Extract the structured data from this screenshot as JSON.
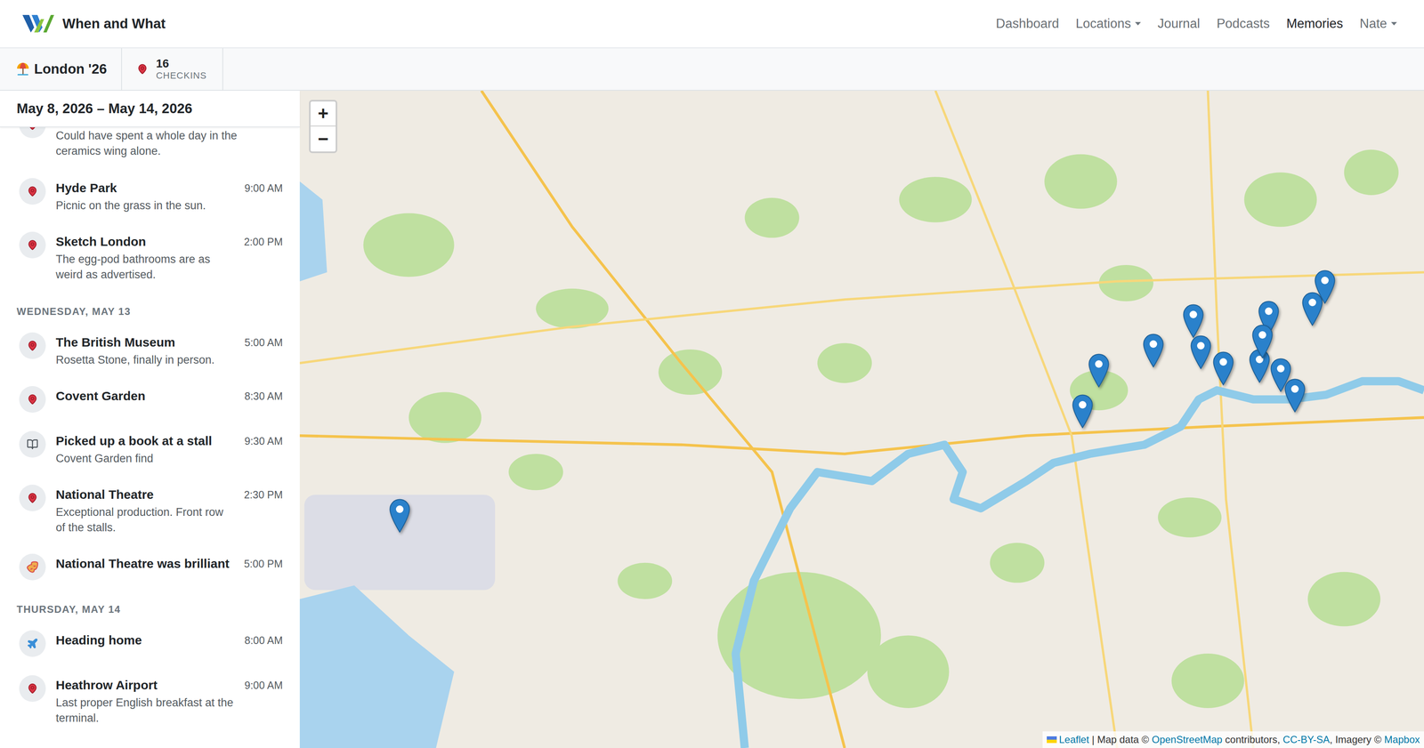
{
  "app": {
    "brand": "When and What"
  },
  "nav": [
    {
      "label": "Dashboard",
      "selected": false,
      "dropdown": false
    },
    {
      "label": "Locations",
      "selected": false,
      "dropdown": true
    },
    {
      "label": "Journal",
      "selected": false,
      "dropdown": false
    },
    {
      "label": "Podcasts",
      "selected": false,
      "dropdown": false
    },
    {
      "label": "Memories",
      "selected": true,
      "dropdown": false
    },
    {
      "label": "Nate",
      "selected": false,
      "dropdown": true
    }
  ],
  "trip": {
    "name": "London '26",
    "checkins_count": "16",
    "checkins_label": "CHECKINS"
  },
  "timeline": {
    "date_range": "May 8, 2026 – May 14, 2026",
    "days": [
      {
        "entries": [
          {
            "kind": "checkin",
            "clipped": true,
            "note": "Could have spent a whole day in the ceramics wing alone."
          },
          {
            "kind": "checkin",
            "clipped": false,
            "title": "Hyde Park",
            "time": "9:00 AM",
            "note": "Picnic on the grass in the sun."
          },
          {
            "kind": "checkin",
            "clipped": false,
            "title": "Sketch London",
            "time": "2:00 PM",
            "note": "The egg-pod bathrooms are as weird as advertised."
          }
        ]
      },
      {
        "label": "WEDNESDAY, MAY 13",
        "entries": [
          {
            "kind": "checkin",
            "clipped": false,
            "title": "The British Museum",
            "time": "5:00 AM",
            "note": "Rosetta Stone, finally in person."
          },
          {
            "kind": "checkin",
            "clipped": false,
            "title": "Covent Garden",
            "time": "8:30 AM"
          },
          {
            "kind": "book",
            "clipped": false,
            "title": "Picked up a book at a stall",
            "time": "9:30 AM",
            "note": "Covent Garden find"
          },
          {
            "kind": "checkin",
            "clipped": false,
            "title": "National Theatre",
            "time": "2:30 PM",
            "note": "Exceptional production. Front row of the stalls."
          },
          {
            "kind": "memory",
            "clipped": false,
            "title": "National Theatre was brilliant",
            "time": "5:00 PM"
          }
        ]
      },
      {
        "label": "THURSDAY, MAY 14",
        "entries": [
          {
            "kind": "flight",
            "clipped": false,
            "title": "Heading home",
            "time": "8:00 AM"
          },
          {
            "kind": "checkin",
            "clipped": false,
            "title": "Heathrow Airport",
            "time": "9:00 AM",
            "note": "Last proper English breakfast at the terminal."
          }
        ]
      }
    ]
  },
  "map": {
    "zoom_in": "+",
    "zoom_out": "−",
    "attribution": [
      {
        "text": "Leaflet",
        "link": true
      },
      {
        "text": " | Map data © ",
        "link": false
      },
      {
        "text": "OpenStreetMap",
        "link": true
      },
      {
        "text": " contributors, ",
        "link": false
      },
      {
        "text": "CC-BY-SA",
        "link": true
      },
      {
        "text": ", Imagery © ",
        "link": false
      },
      {
        "text": "Mapbox",
        "link": true
      }
    ],
    "pins": [
      {
        "lat": 51.4695,
        "lng": -0.454
      },
      {
        "lat": 51.4973,
        "lng": -0.1625
      },
      {
        "lat": 51.5081,
        "lng": -0.1555
      },
      {
        "lat": 51.5134,
        "lng": -0.1322
      },
      {
        "lat": 51.5212,
        "lng": -0.1151
      },
      {
        "lat": 51.513,
        "lng": -0.112
      },
      {
        "lat": 51.5086,
        "lng": -0.1024
      },
      {
        "lat": 51.5093,
        "lng": -0.0869
      },
      {
        "lat": 51.5221,
        "lng": -0.083
      },
      {
        "lat": 51.5158,
        "lng": -0.0857
      },
      {
        "lat": 51.5069,
        "lng": -0.0779
      },
      {
        "lat": 51.5014,
        "lng": -0.0717
      },
      {
        "lat": 51.5245,
        "lng": -0.0644
      },
      {
        "lat": 51.5303,
        "lng": -0.0589
      }
    ]
  }
}
